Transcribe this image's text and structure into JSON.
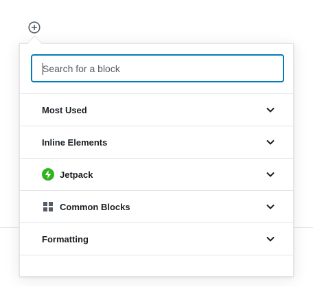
{
  "inserter": {
    "toggle_icon": "plus-circle-icon"
  },
  "search": {
    "placeholder": "Search for a block",
    "value": ""
  },
  "panels": [
    {
      "label": "Most Used",
      "icon": null
    },
    {
      "label": "Inline Elements",
      "icon": null
    },
    {
      "label": "Jetpack",
      "icon": "jetpack-icon",
      "icon_color": "#2fb41f"
    },
    {
      "label": "Common Blocks",
      "icon": "grid-blocks-icon",
      "icon_color": "#555d66"
    },
    {
      "label": "Formatting",
      "icon": null
    }
  ],
  "colors": {
    "focus_border": "#007cba",
    "divider": "#e2e4e7",
    "text": "#191e23"
  }
}
